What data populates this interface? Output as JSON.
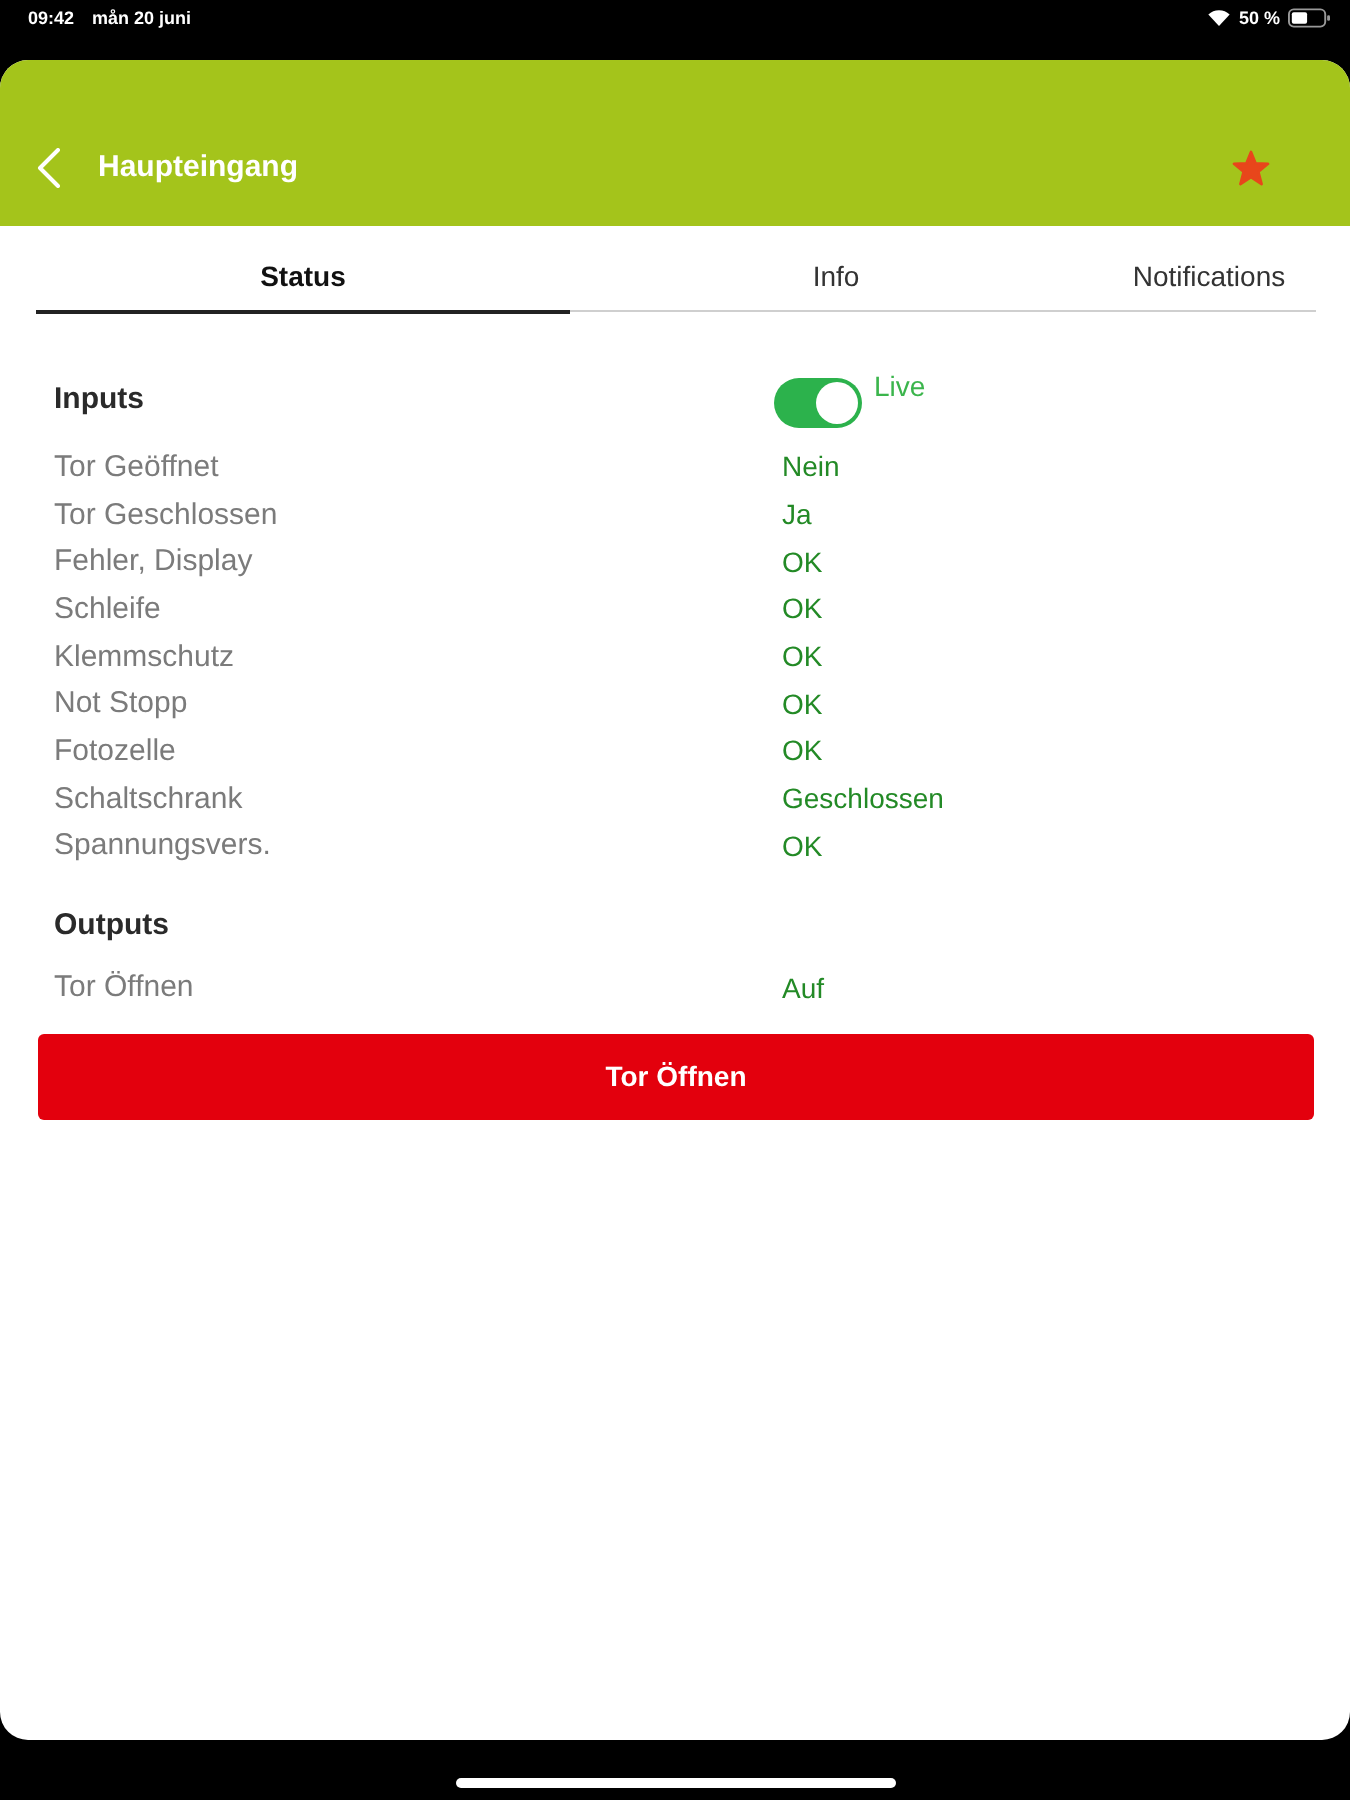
{
  "status_bar": {
    "time": "09:42",
    "date": "mån 20 juni",
    "battery_text": "50 %"
  },
  "header": {
    "title": "Haupteingang",
    "favorite": true
  },
  "tabs": [
    {
      "label": "Status",
      "selected": true
    },
    {
      "label": "Info",
      "selected": false
    },
    {
      "label": "Notifications",
      "selected": false
    }
  ],
  "inputs": {
    "heading": "Inputs",
    "live_toggle": {
      "label": "Live",
      "on": true
    },
    "rows": [
      {
        "label": "Tor Geöffnet",
        "value": "Nein"
      },
      {
        "label": "Tor Geschlossen",
        "value": "Ja"
      },
      {
        "label": "Fehler, Display",
        "value": "OK"
      },
      {
        "label": "Schleife",
        "value": "OK"
      },
      {
        "label": "Klemmschutz",
        "value": "OK"
      },
      {
        "label": "Not Stopp",
        "value": "OK"
      },
      {
        "label": "Fotozelle",
        "value": "OK"
      },
      {
        "label": "Schaltschrank",
        "value": "Geschlossen"
      },
      {
        "label": "Spannungsvers.",
        "value": "OK"
      }
    ]
  },
  "outputs": {
    "heading": "Outputs",
    "rows": [
      {
        "label": "Tor Öffnen",
        "value": "Auf"
      }
    ]
  },
  "action_button": {
    "label": "Tor Öffnen"
  }
}
